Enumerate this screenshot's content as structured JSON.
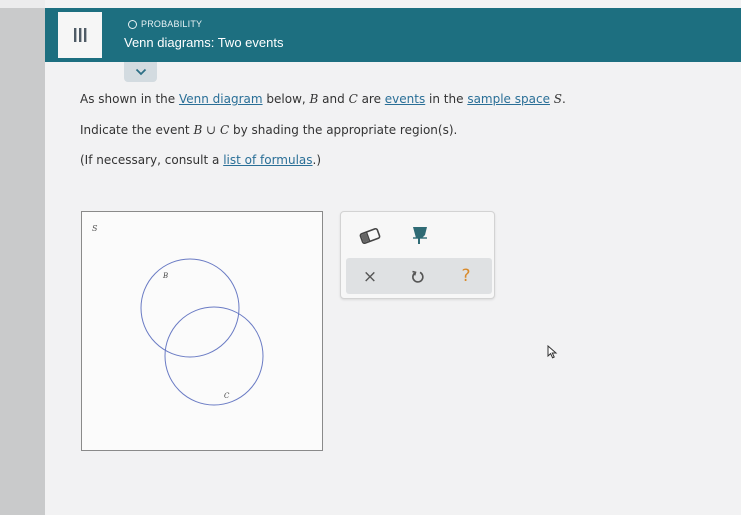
{
  "header": {
    "section_label": "PROBABILITY",
    "title": "Venn diagrams: Two events"
  },
  "question": {
    "line1": {
      "p1": "As shown in the ",
      "link1": "Venn diagram",
      "p2": " below, ",
      "setB": "B",
      "p3": " and ",
      "setC": "C",
      "p4": " are ",
      "link2": "events",
      "p5": " in the ",
      "link3": "sample space",
      "p6": " ",
      "space": "S",
      "p7": "."
    },
    "line2": {
      "p1": "Indicate the event ",
      "expr": "B ∪ C",
      "p2": " by shading the appropriate region(s)."
    },
    "line3": {
      "p1": "(If necessary, consult a ",
      "link": "list of formulas",
      "p2": ".)"
    }
  },
  "venn": {
    "space_label": "S",
    "set1_label": "B",
    "set2_label": "C",
    "circle_color": "#6a7bc4"
  },
  "tools": {
    "clear": "×",
    "help": "?"
  },
  "colors": {
    "header": "#1d6f80",
    "link": "#2a6f97",
    "help": "#d98a2b"
  }
}
